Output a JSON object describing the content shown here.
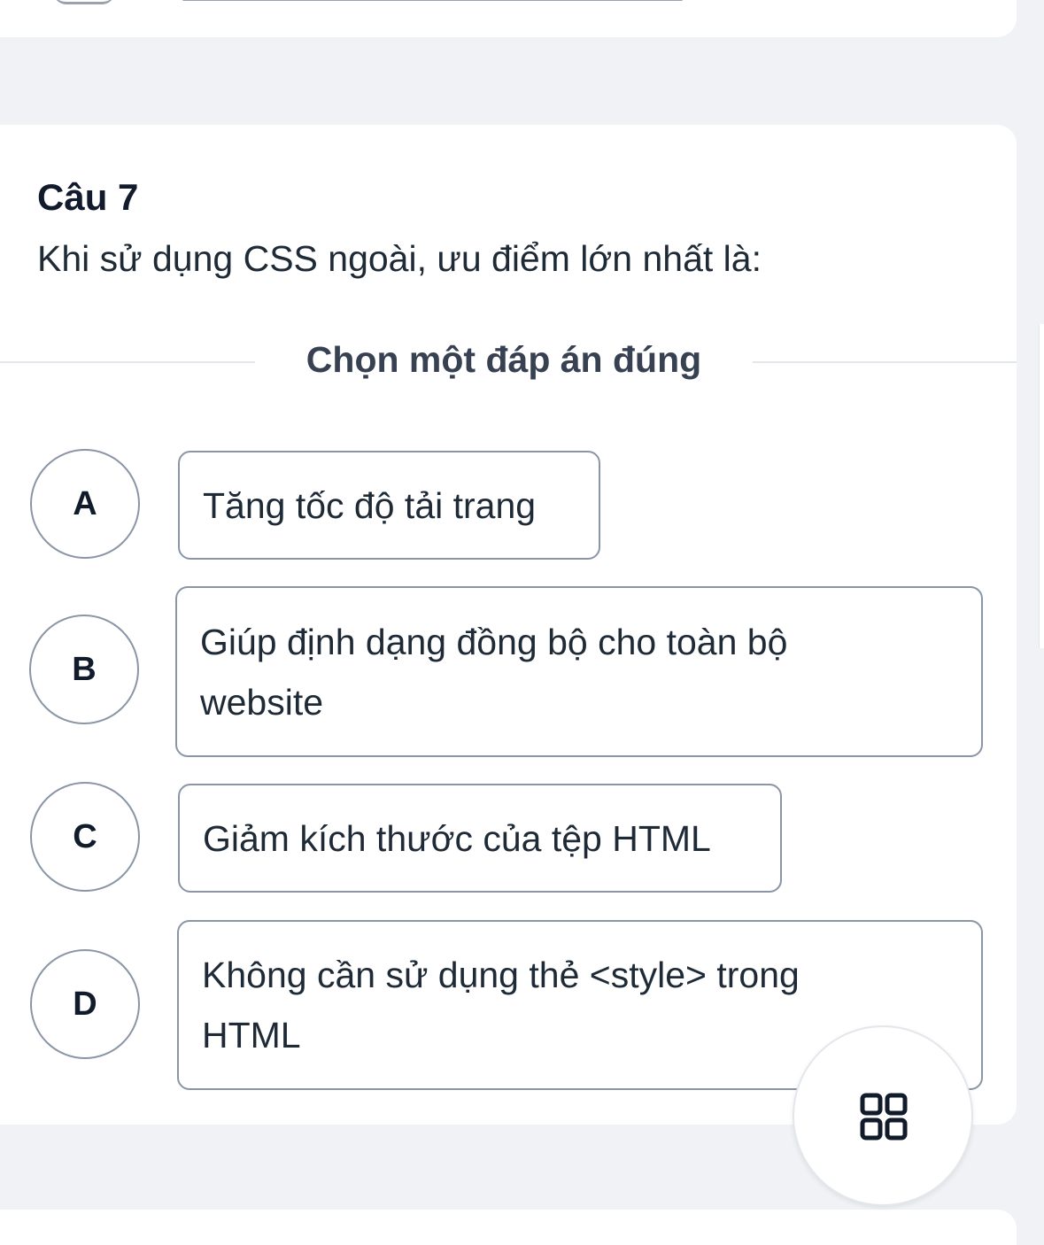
{
  "question": {
    "number_label": "Câu 7",
    "text": "Khi sử dụng CSS ngoài, ưu điểm lớn nhất là:",
    "instruction": "Chọn một đáp án đúng"
  },
  "options": [
    {
      "letter": "A",
      "text": "Tăng tốc độ tải trang"
    },
    {
      "letter": "B",
      "text": "Giúp định dạng đồng bộ cho toàn bộ website"
    },
    {
      "letter": "C",
      "text": "Giảm kích thước của tệp HTML"
    },
    {
      "letter": "D",
      "text": "Không cần sử dụng thẻ <style> trong HTML"
    }
  ],
  "fab": {
    "icon": "grid-icon"
  },
  "colors": {
    "page_bg": "#f0f2f5",
    "card_bg": "#ffffff",
    "border": "#8a96a5",
    "text": "#1f2a37"
  }
}
